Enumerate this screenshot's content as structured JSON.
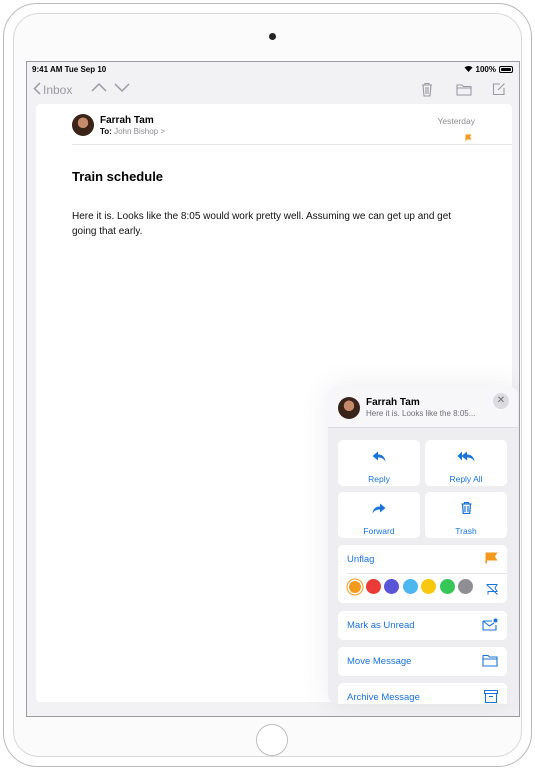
{
  "status": {
    "time": "9:41 AM  Tue Sep 10",
    "battery": "100%"
  },
  "nav": {
    "back_label": "Inbox"
  },
  "message": {
    "sender": "Farrah Tam",
    "to_label": "To:",
    "to_name": "John Bishop >",
    "date": "Yesterday",
    "subject": "Train schedule",
    "body": "Here it is. Looks like the 8:05 would work pretty well. Assuming we can get up and get going that early."
  },
  "popover": {
    "sender": "Farrah Tam",
    "preview": "Here it is. Looks like the 8:05...",
    "close": "✕",
    "tiles": {
      "reply": "Reply",
      "reply_all": "Reply All",
      "forward": "Forward",
      "trash": "Trash"
    },
    "unflag": "Unflag",
    "flag_colors": [
      "#f39a1e",
      "#ea3b36",
      "#5a54d6",
      "#4cb6ee",
      "#f9c80e",
      "#37c759",
      "#8e8e93"
    ],
    "mark_unread": "Mark as Unread",
    "move": "Move Message",
    "archive": "Archive Message"
  },
  "colors": {
    "accent": "#1a73d9",
    "flag": "#f39a1e"
  },
  "icons": [
    "wifi-icon",
    "battery-icon",
    "chevron-left-icon",
    "chevron-up-icon",
    "chevron-down-icon",
    "trash-icon",
    "folder-icon",
    "compose-icon",
    "flag-icon",
    "reply-icon",
    "reply-all-icon",
    "forward-icon",
    "no-flag-icon",
    "envelope-badge-icon",
    "archive-icon",
    "close-icon"
  ]
}
